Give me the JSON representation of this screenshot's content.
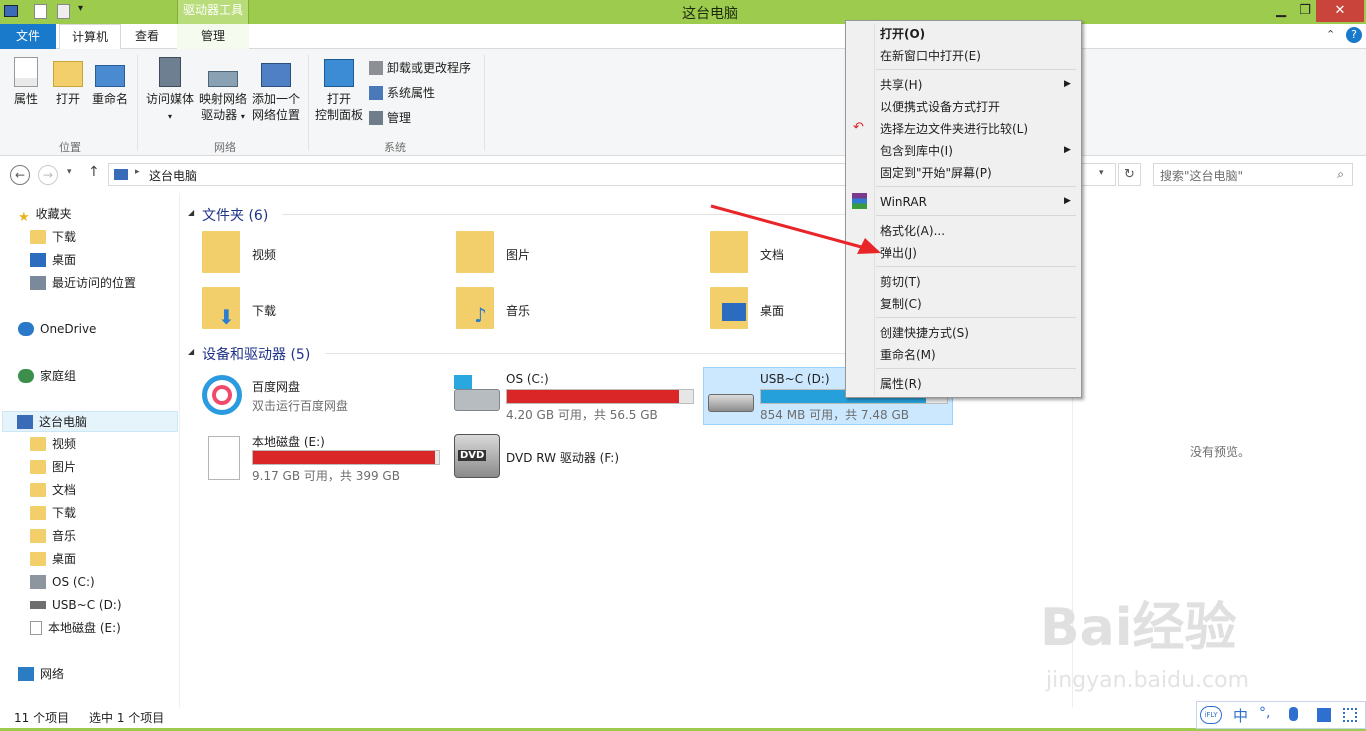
{
  "window": {
    "title": "这台电脑",
    "context_tab_group": "驱动器工具",
    "minimize": "▁",
    "maximize": "❐",
    "close": "✕"
  },
  "tabs": {
    "file": "文件",
    "computer": "计算机",
    "view": "查看",
    "manage": "管理"
  },
  "ribbon": {
    "location": {
      "label": "位置",
      "properties": "属性",
      "open": "打开",
      "rename": "重命名"
    },
    "network": {
      "label": "网络",
      "access_media": "访问媒体",
      "map_drive_1": "映射网络",
      "map_drive_2": "驱动器",
      "add_location_1": "添加一个",
      "add_location_2": "网络位置"
    },
    "system": {
      "label": "系统",
      "open_cp_1": "打开",
      "open_cp_2": "控制面板",
      "uninstall": "卸载或更改程序",
      "sys_props": "系统属性",
      "manage": "管理"
    }
  },
  "address": {
    "path": "这台电脑",
    "search_placeholder": "搜索\"这台电脑\""
  },
  "nav": {
    "favorites": "收藏夹",
    "downloads": "下载",
    "desktop": "桌面",
    "recent": "最近访问的位置",
    "onedrive": "OneDrive",
    "homegroup": "家庭组",
    "this_pc": "这台电脑",
    "videos": "视频",
    "pictures": "图片",
    "documents": "文档",
    "downloads2": "下载",
    "music": "音乐",
    "desktop2": "桌面",
    "os_c": "OS (C:)",
    "usb_d": "USB~C (D:)",
    "local_e": "本地磁盘 (E:)",
    "network": "网络"
  },
  "folders": {
    "header": "文件夹 (6)",
    "items": [
      "视频",
      "图片",
      "文档",
      "下载",
      "音乐",
      "桌面"
    ]
  },
  "devices": {
    "header": "设备和驱动器 (5)",
    "baidu": {
      "name": "百度网盘",
      "sub": "双击运行百度网盘"
    },
    "os_c": {
      "name": "OS (C:)",
      "sub": "4.20 GB 可用，共 56.5 GB",
      "fill": 0.926
    },
    "usb_d": {
      "name": "USB~C (D:)",
      "sub": "854 MB 可用，共 7.48 GB",
      "fill": 0.889
    },
    "local_e": {
      "name": "本地磁盘 (E:)",
      "sub": "9.17 GB 可用，共 399 GB",
      "fill": 0.977
    },
    "dvd": {
      "name": "DVD RW 驱动器 (F:)",
      "badge": "DVD"
    }
  },
  "preview": {
    "empty": "没有预览。"
  },
  "status": {
    "count": "11 个项目",
    "selected": "选中 1 个项目"
  },
  "context_menu": {
    "open": "打开(O)",
    "open_new": "在新窗口中打开(E)",
    "share": "共享(H)",
    "open_portable": "以便携式设备方式打开",
    "compare": "选择左边文件夹进行比较(L)",
    "include_library": "包含到库中(I)",
    "pin_start": "固定到\"开始\"屏幕(P)",
    "winrar": "WinRAR",
    "format": "格式化(A)...",
    "eject": "弹出(J)",
    "cut": "剪切(T)",
    "copy": "复制(C)",
    "shortcut": "创建快捷方式(S)",
    "rename": "重命名(M)",
    "properties": "属性(R)"
  },
  "ime": {
    "mode": "中",
    "logo": "iFLY"
  },
  "watermark": {
    "brand": "Bai经验",
    "url": "jingyan.baidu.com"
  },
  "colors": {
    "title_green": "#9ccb4d",
    "file_tab_blue": "#1979ca",
    "bar_red": "#da2626",
    "bar_blue": "#26a0da",
    "arrow_red": "#e8262a"
  }
}
